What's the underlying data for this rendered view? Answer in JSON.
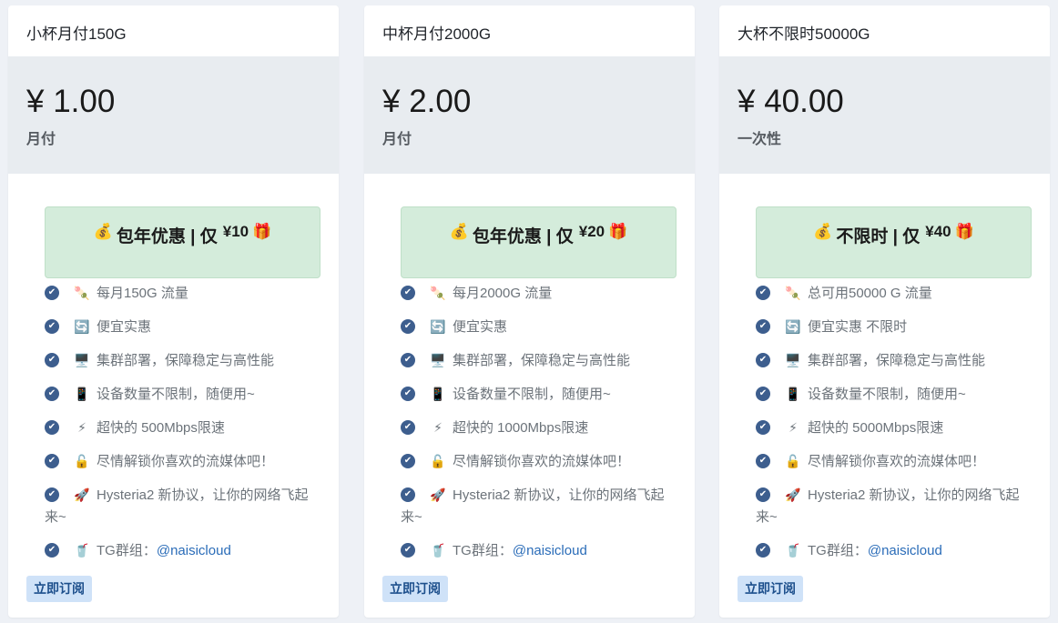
{
  "plans": [
    {
      "name": "小杯月付150G",
      "price": "¥ 1.00",
      "period": "月付",
      "promo": {
        "icon_left": "💰",
        "text": "包年优惠 | 仅",
        "amount": "¥10",
        "icon_right": "🎁"
      },
      "features": [
        {
          "icon": "🍡",
          "text": "每月150G 流量"
        },
        {
          "icon": "🔄",
          "text": "便宜实惠"
        },
        {
          "icon": "🖥️",
          "text": "集群部署，保障稳定与高性能"
        },
        {
          "icon": "📱",
          "text": "设备数量不限制，随便用~"
        },
        {
          "icon": "⚡",
          "text": "超快的 500Mbps限速"
        },
        {
          "icon": "🔓",
          "text": "尽情解锁你喜欢的流媒体吧！"
        },
        {
          "icon": "🚀",
          "text": "Hysteria2 新协议，让你的网络飞起来~"
        }
      ],
      "tg": {
        "icon": "🥤",
        "label": "TG群组：",
        "link": "@naisicloud"
      },
      "subscribe_label": "立即订阅"
    },
    {
      "name": "中杯月付2000G",
      "price": "¥ 2.00",
      "period": "月付",
      "promo": {
        "icon_left": "💰",
        "text": "包年优惠 | 仅",
        "amount": "¥20",
        "icon_right": "🎁"
      },
      "features": [
        {
          "icon": "🍡",
          "text": "每月2000G 流量"
        },
        {
          "icon": "🔄",
          "text": "便宜实惠"
        },
        {
          "icon": "🖥️",
          "text": "集群部署，保障稳定与高性能"
        },
        {
          "icon": "📱",
          "text": "设备数量不限制，随便用~"
        },
        {
          "icon": "⚡",
          "text": "超快的 1000Mbps限速"
        },
        {
          "icon": "🔓",
          "text": "尽情解锁你喜欢的流媒体吧！"
        },
        {
          "icon": "🚀",
          "text": "Hysteria2 新协议，让你的网络飞起来~"
        }
      ],
      "tg": {
        "icon": "🥤",
        "label": "TG群组：",
        "link": "@naisicloud"
      },
      "subscribe_label": "立即订阅"
    },
    {
      "name": "大杯不限时50000G",
      "price": "¥ 40.00",
      "period": "一次性",
      "promo": {
        "icon_left": "💰",
        "text": "不限时 | 仅",
        "amount": "¥40",
        "icon_right": "🎁"
      },
      "features": [
        {
          "icon": "🍡",
          "text": "总可用50000 G 流量"
        },
        {
          "icon": "🔄",
          "text": "便宜实惠 不限时"
        },
        {
          "icon": "🖥️",
          "text": "集群部署，保障稳定与高性能"
        },
        {
          "icon": "📱",
          "text": "设备数量不限制，随便用~"
        },
        {
          "icon": "⚡",
          "text": "超快的 5000Mbps限速"
        },
        {
          "icon": "🔓",
          "text": "尽情解锁你喜欢的流媒体吧！"
        },
        {
          "icon": "🚀",
          "text": "Hysteria2 新协议，让你的网络飞起来~"
        }
      ],
      "tg": {
        "icon": "🥤",
        "label": "TG群组：",
        "link": "@naisicloud"
      },
      "subscribe_label": "立即订阅"
    }
  ],
  "check_icon": "check-circle-icon",
  "colors": {
    "accent": "#3d5e8e",
    "promo_bg": "#d4ecdb",
    "price_bg": "#e8ecf0",
    "button_bg": "#cfe2f8",
    "link": "#2a6cb8"
  }
}
